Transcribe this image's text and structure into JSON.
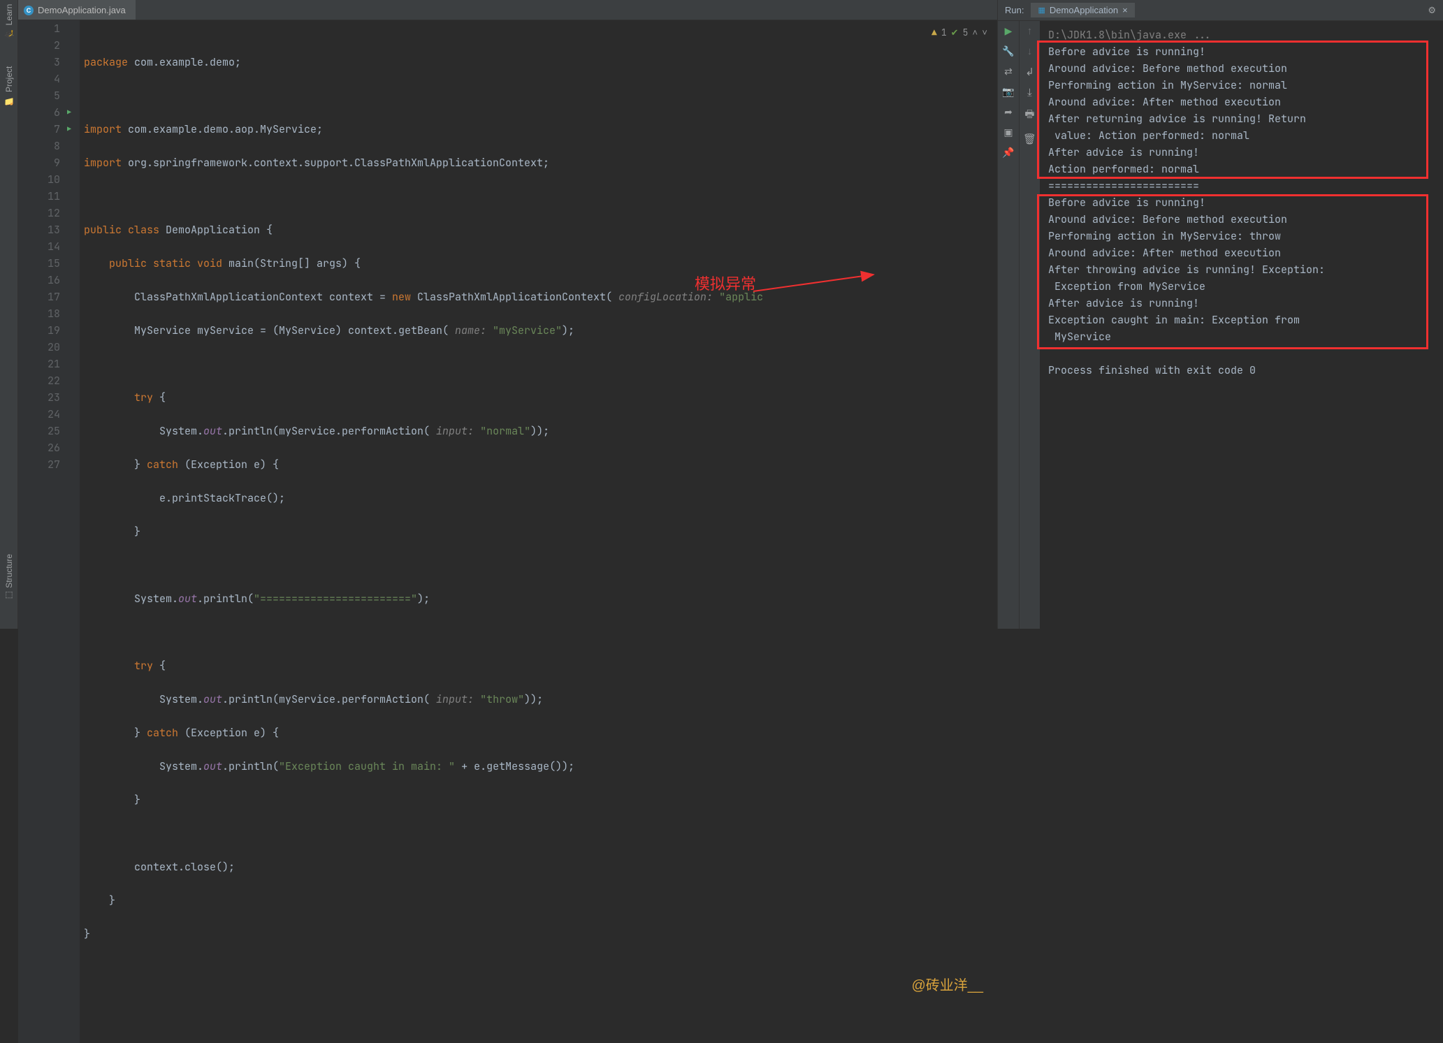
{
  "leftStrip": {
    "learn": "Learn",
    "project": "Project",
    "structure": "Structure"
  },
  "tab": {
    "file": "DemoApplication.java"
  },
  "gutter": {
    "lines": [
      "1",
      "2",
      "3",
      "4",
      "5",
      "6",
      "7",
      "8",
      "9",
      "10",
      "11",
      "12",
      "13",
      "14",
      "15",
      "16",
      "17",
      "18",
      "19",
      "20",
      "21",
      "22",
      "23",
      "24",
      "25",
      "26",
      "27"
    ]
  },
  "status": {
    "warn": "1",
    "ok": "5"
  },
  "code": {
    "l1_a": "package ",
    "l1_b": "com.example.demo;",
    "l3_a": "import ",
    "l3_b": "com.example.demo.aop.MyService;",
    "l4_a": "import ",
    "l4_b": "org.springframework.context.support.ClassPathXmlApplicationContext;",
    "l6_a": "public class ",
    "l6_b": "DemoApplication {",
    "l7_a": "    public static void ",
    "l7_b": "main(String[] args) {",
    "l8_a": "        ClassPathXmlApplicationContext context = ",
    "l8_b": "new ",
    "l8_c": "ClassPathXmlApplicationContext( ",
    "l8_d": "configLocation: ",
    "l8_e": "\"applic",
    "l9_a": "        MyService myService = (MyService) context.getBean( ",
    "l9_b": "name: ",
    "l9_c": "\"myService\"",
    "l9_d": ");",
    "l11_a": "        try ",
    "l11_b": "{",
    "l12_a": "            System.",
    "l12_b": "out",
    "l12_c": ".println(myService.performAction( ",
    "l12_d": "input: ",
    "l12_e": "\"normal\"",
    "l12_f": "));",
    "l13_a": "        } ",
    "l13_b": "catch ",
    "l13_c": "(Exception e) {",
    "l14": "            e.printStackTrace();",
    "l15": "        }",
    "l17_a": "        System.",
    "l17_b": "out",
    "l17_c": ".println(",
    "l17_d": "\"========================\"",
    "l17_e": ");",
    "l19_a": "        try ",
    "l19_b": "{",
    "l20_a": "            System.",
    "l20_b": "out",
    "l20_c": ".println(myService.performAction( ",
    "l20_d": "input: ",
    "l20_e": "\"throw\"",
    "l20_f": "));",
    "l21_a": "        } ",
    "l21_b": "catch ",
    "l21_c": "(Exception e) {",
    "l22_a": "            System.",
    "l22_b": "out",
    "l22_c": ".println(",
    "l22_d": "\"Exception caught in main: \"",
    "l22_e": " + e.getMessage());",
    "l23": "        }",
    "l25": "        context.close();",
    "l26": "    }",
    "l27": "}"
  },
  "runTab": {
    "label": "Run:",
    "app": "DemoApplication"
  },
  "console": {
    "cmd": "D:\\JDK1.8\\bin\\java.exe ...",
    "l": [
      "Before advice is running!",
      "Around advice: Before method execution",
      "Performing action in MyService: normal",
      "Around advice: After method execution",
      "After returning advice is running! Return",
      " value: Action performed: normal",
      "After advice is running!",
      "Action performed: normal",
      "========================",
      "Before advice is running!",
      "Around advice: Before method execution",
      "Performing action in MyService: throw",
      "Around advice: After method execution",
      "After throwing advice is running! Exception:",
      " Exception from MyService",
      "After advice is running!",
      "Exception caught in main: Exception from",
      " MyService",
      "",
      "Process finished with exit code 0"
    ]
  },
  "annotation": {
    "label": "模拟异常",
    "watermark": "@砖业洋__"
  }
}
